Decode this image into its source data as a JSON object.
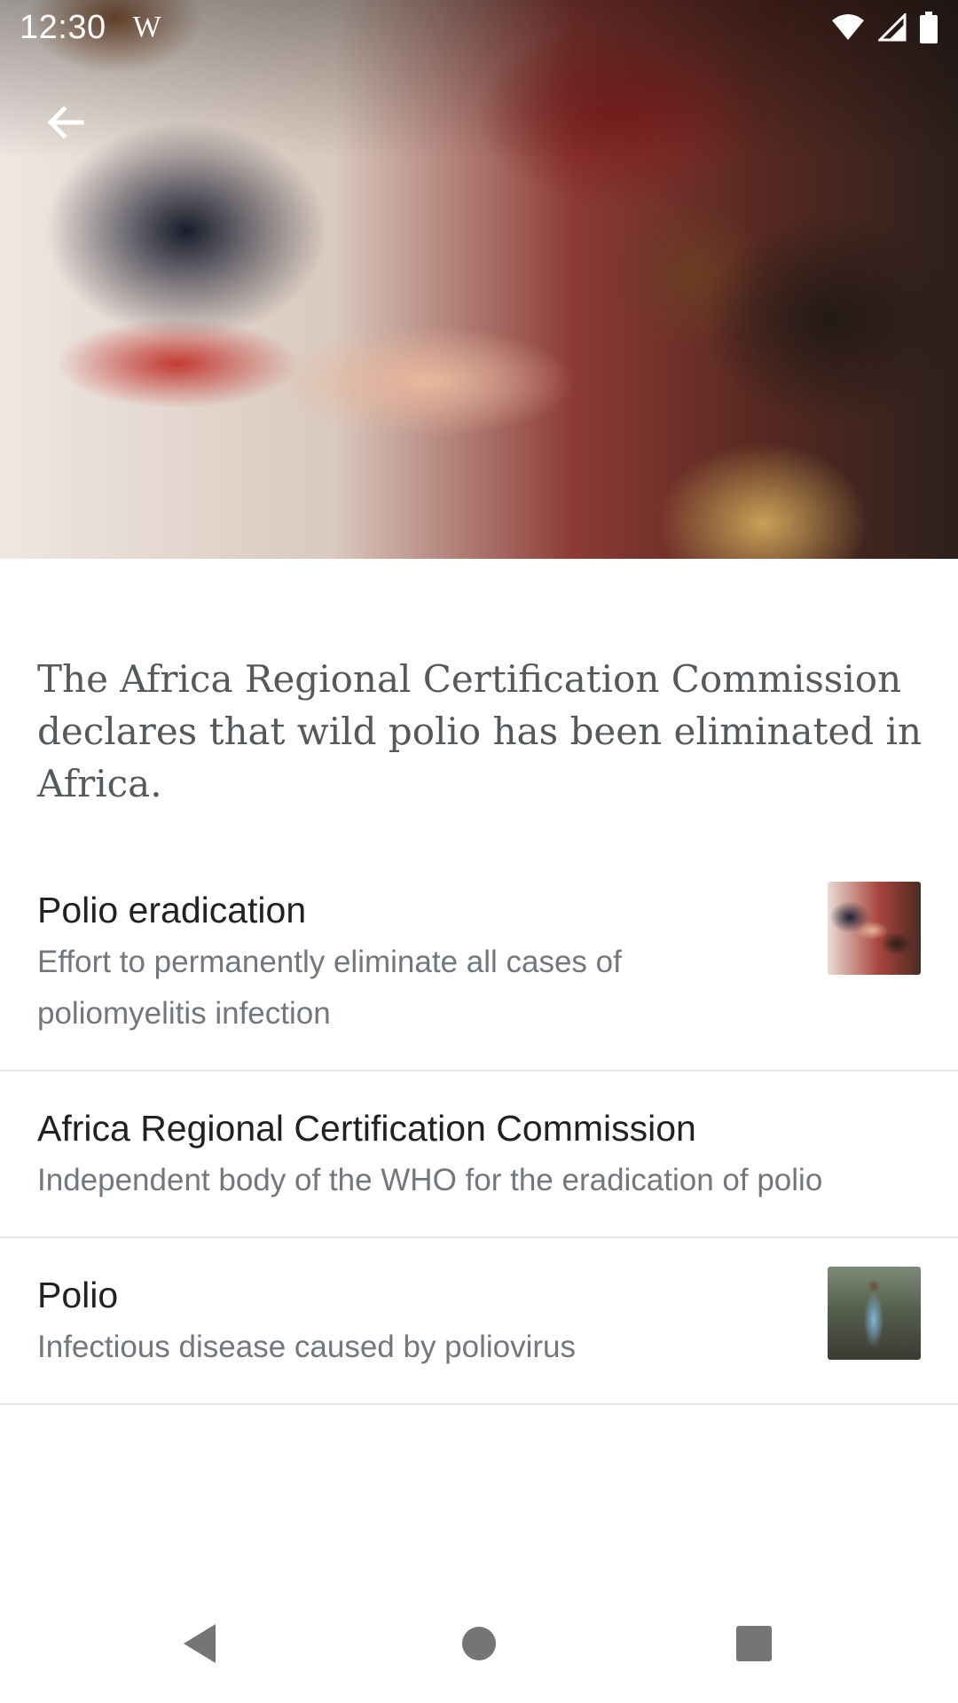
{
  "status_bar": {
    "time": "12:30",
    "app_icon": "W"
  },
  "icons": {
    "back": "arrow-left-icon",
    "wifi": "wifi-icon",
    "signal": "signal-icon",
    "battery": "battery-icon"
  },
  "hero": {
    "alt": "Hero image: child receiving oral polio vaccine"
  },
  "extract": "The Africa Regional Certification Commission declares that wild polio has been eliminated in Africa.",
  "articles": [
    {
      "title": "Polio eradication",
      "description": "Effort to permanently eliminate all cases of poliomyelitis infection"
    },
    {
      "title": "Africa Regional Certification Commission",
      "description": "Independent body of the WHO for the eradication of polio"
    },
    {
      "title": "Polio",
      "description": "Infectious disease caused by poliovirus"
    }
  ],
  "colors": {
    "title": "#202122",
    "description": "#72777d",
    "extract": "#54595d",
    "divider": "#e6e6e6"
  }
}
